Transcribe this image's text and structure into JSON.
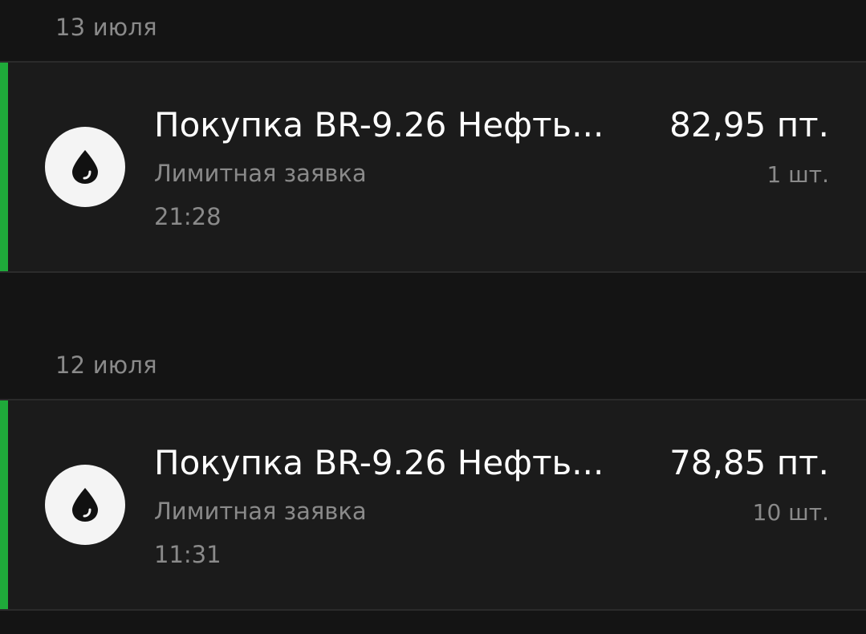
{
  "colors": {
    "background": "#141414",
    "card_background": "#1b1b1b",
    "buy_accent": "#1faa3a",
    "icon_bg": "#f4f4f4",
    "icon_fg": "#111111",
    "primary_text": "#ffffff",
    "secondary_text": "#8a8a8a"
  },
  "groups": [
    {
      "date": "13 июля",
      "operations": [
        {
          "icon": "oil-drop-icon",
          "title": "Покупка BR-9.26 Нефть...",
          "amount": "82,95 пт.",
          "subtitle": "Лимитная заявка",
          "quantity": "1 шт.",
          "time": "21:28"
        }
      ]
    },
    {
      "date": "12 июля",
      "operations": [
        {
          "icon": "oil-drop-icon",
          "title": "Покупка BR-9.26 Нефть...",
          "amount": "78,85 пт.",
          "subtitle": "Лимитная заявка",
          "quantity": "10 шт.",
          "time": "11:31"
        }
      ]
    }
  ]
}
